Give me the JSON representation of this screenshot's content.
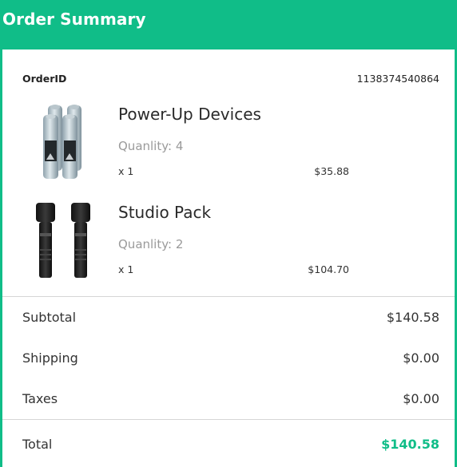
{
  "header": {
    "title": "Order Summary"
  },
  "order": {
    "id_label": "OrderID",
    "id_value": "1138374540864"
  },
  "items": [
    {
      "name": "Power-Up Devices",
      "quantity": "Quanlity: 4",
      "multiplier": "x 1",
      "price": "$35.88",
      "icon": "battery-pack-icon"
    },
    {
      "name": "Studio Pack",
      "quantity": "Quanlity: 2",
      "multiplier": "x 1",
      "price": "$104.70",
      "icon": "flashlight-pack-icon"
    }
  ],
  "summary": {
    "subtotal_label": "Subtotal",
    "subtotal_value": "$140.58",
    "shipping_label": "Shipping",
    "shipping_value": "$0.00",
    "taxes_label": "Taxes",
    "taxes_value": "$0.00",
    "total_label": "Total",
    "total_value": "$140.58"
  },
  "colors": {
    "accent": "#10bd88",
    "divider": "#d6d6d6"
  }
}
